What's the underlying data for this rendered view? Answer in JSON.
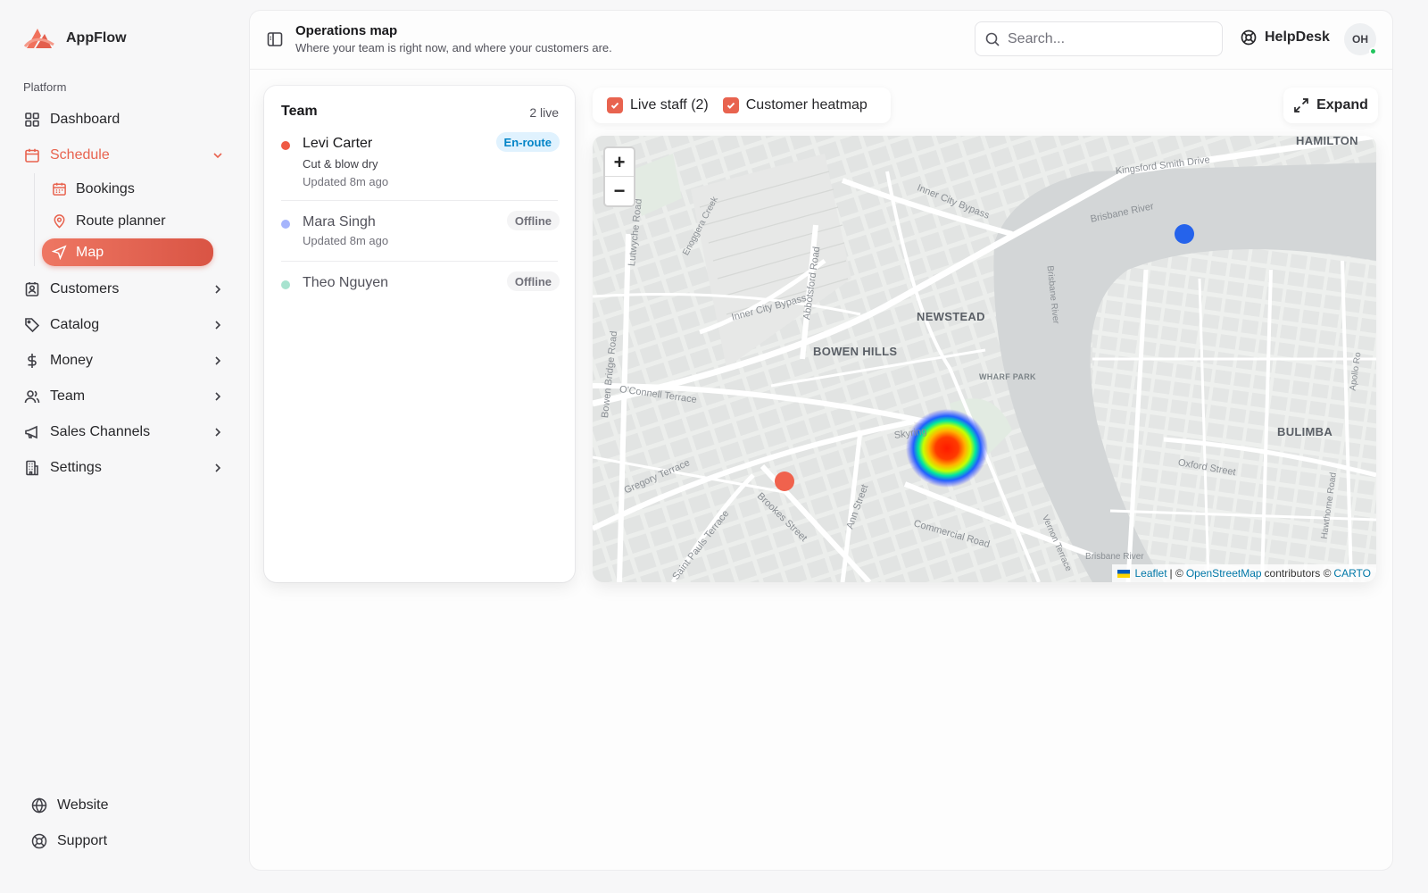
{
  "app": {
    "name": "AppFlow"
  },
  "sidebar": {
    "section_label": "Platform",
    "items": [
      {
        "label": "Dashboard",
        "icon": "dashboard-icon"
      },
      {
        "label": "Schedule",
        "icon": "calendar-icon",
        "expanded": true
      },
      {
        "label": "Customers",
        "icon": "contact-icon"
      },
      {
        "label": "Catalog",
        "icon": "tag-icon"
      },
      {
        "label": "Money",
        "icon": "dollar-icon"
      },
      {
        "label": "Team",
        "icon": "users-icon"
      },
      {
        "label": "Sales Channels",
        "icon": "megaphone-icon"
      },
      {
        "label": "Settings",
        "icon": "building-icon"
      }
    ],
    "schedule_children": [
      {
        "label": "Bookings",
        "icon": "calendar-icon"
      },
      {
        "label": "Route planner",
        "icon": "map-pin-icon"
      },
      {
        "label": "Map",
        "icon": "navigation-icon",
        "selected": true
      }
    ],
    "footer": [
      {
        "label": "Website",
        "icon": "globe-icon"
      },
      {
        "label": "Support",
        "icon": "lifebuoy-icon"
      }
    ],
    "accent": "#e8634f"
  },
  "header": {
    "title": "Operations map",
    "subtitle": "Where your team is right now, and where your customers are.",
    "search_placeholder": "Search...",
    "helpdesk_label": "HelpDesk",
    "avatar_initials": "OH"
  },
  "team": {
    "title": "Team",
    "live_count": "2 live",
    "members": [
      {
        "name": "Levi Carter",
        "service": "Cut & blow dry",
        "updated": "Updated 8m ago",
        "status": "En-route",
        "dot_color": "#ef5a44"
      },
      {
        "name": "Mara Singh",
        "updated": "Updated 8m ago",
        "status": "Offline",
        "dot_color": "#a5b4fc"
      },
      {
        "name": "Theo Nguyen",
        "status": "Offline",
        "dot_color": "#a7e3cf"
      }
    ]
  },
  "map": {
    "toggles": [
      {
        "label": "Live staff (2)",
        "checked": true
      },
      {
        "label": "Customer heatmap",
        "checked": true
      }
    ],
    "expand_label": "Expand",
    "zoom_in": "+",
    "zoom_out": "−",
    "places": {
      "hamilton": "HAMILTON",
      "newstead": "NEWSTEAD",
      "bowen_hills": "BOWEN HILLS",
      "bulimba": "BULIMBA",
      "wharf_park": "WHARF PARK"
    },
    "streets": {
      "kingsford": "Kingsford Smith Drive",
      "brisbane_river": "Brisbane River",
      "brisbane_river_2": "Brisbane River",
      "bisbane_river_vertical": "Brisbane River",
      "inner_city_bypass": "Inner City Bypass",
      "inner_city_bypass_2": "Inner City Bypass",
      "abbotsford": "Abbotsford Road",
      "lutwyche": "Lutwyche Road",
      "enoggera": "Enoggera Creek",
      "oconnell": "O'Connell Terrace",
      "bowen_bridge": "Bowen Bridge Road",
      "gregory": "Gregory Terrace",
      "saint_pauls": "Saint Pauls Terrace",
      "brookes": "Brookes Street",
      "ann": "Ann Street",
      "commercial": "Commercial Road",
      "skyring": "Skyring",
      "vernon": "Vernon Terrace",
      "oxford": "Oxford Street",
      "hawthorne": "Hawthorne Road",
      "apollo": "Apollo Ro"
    },
    "attribution": {
      "leaflet": "Leaflet",
      "sep": "| ©",
      "osm": "OpenStreetMap",
      "contributors": "contributors ©",
      "carto": "CARTO"
    },
    "marker_colors": {
      "staff_en_route": "#f0624d",
      "staff_other": "#2563eb"
    }
  }
}
